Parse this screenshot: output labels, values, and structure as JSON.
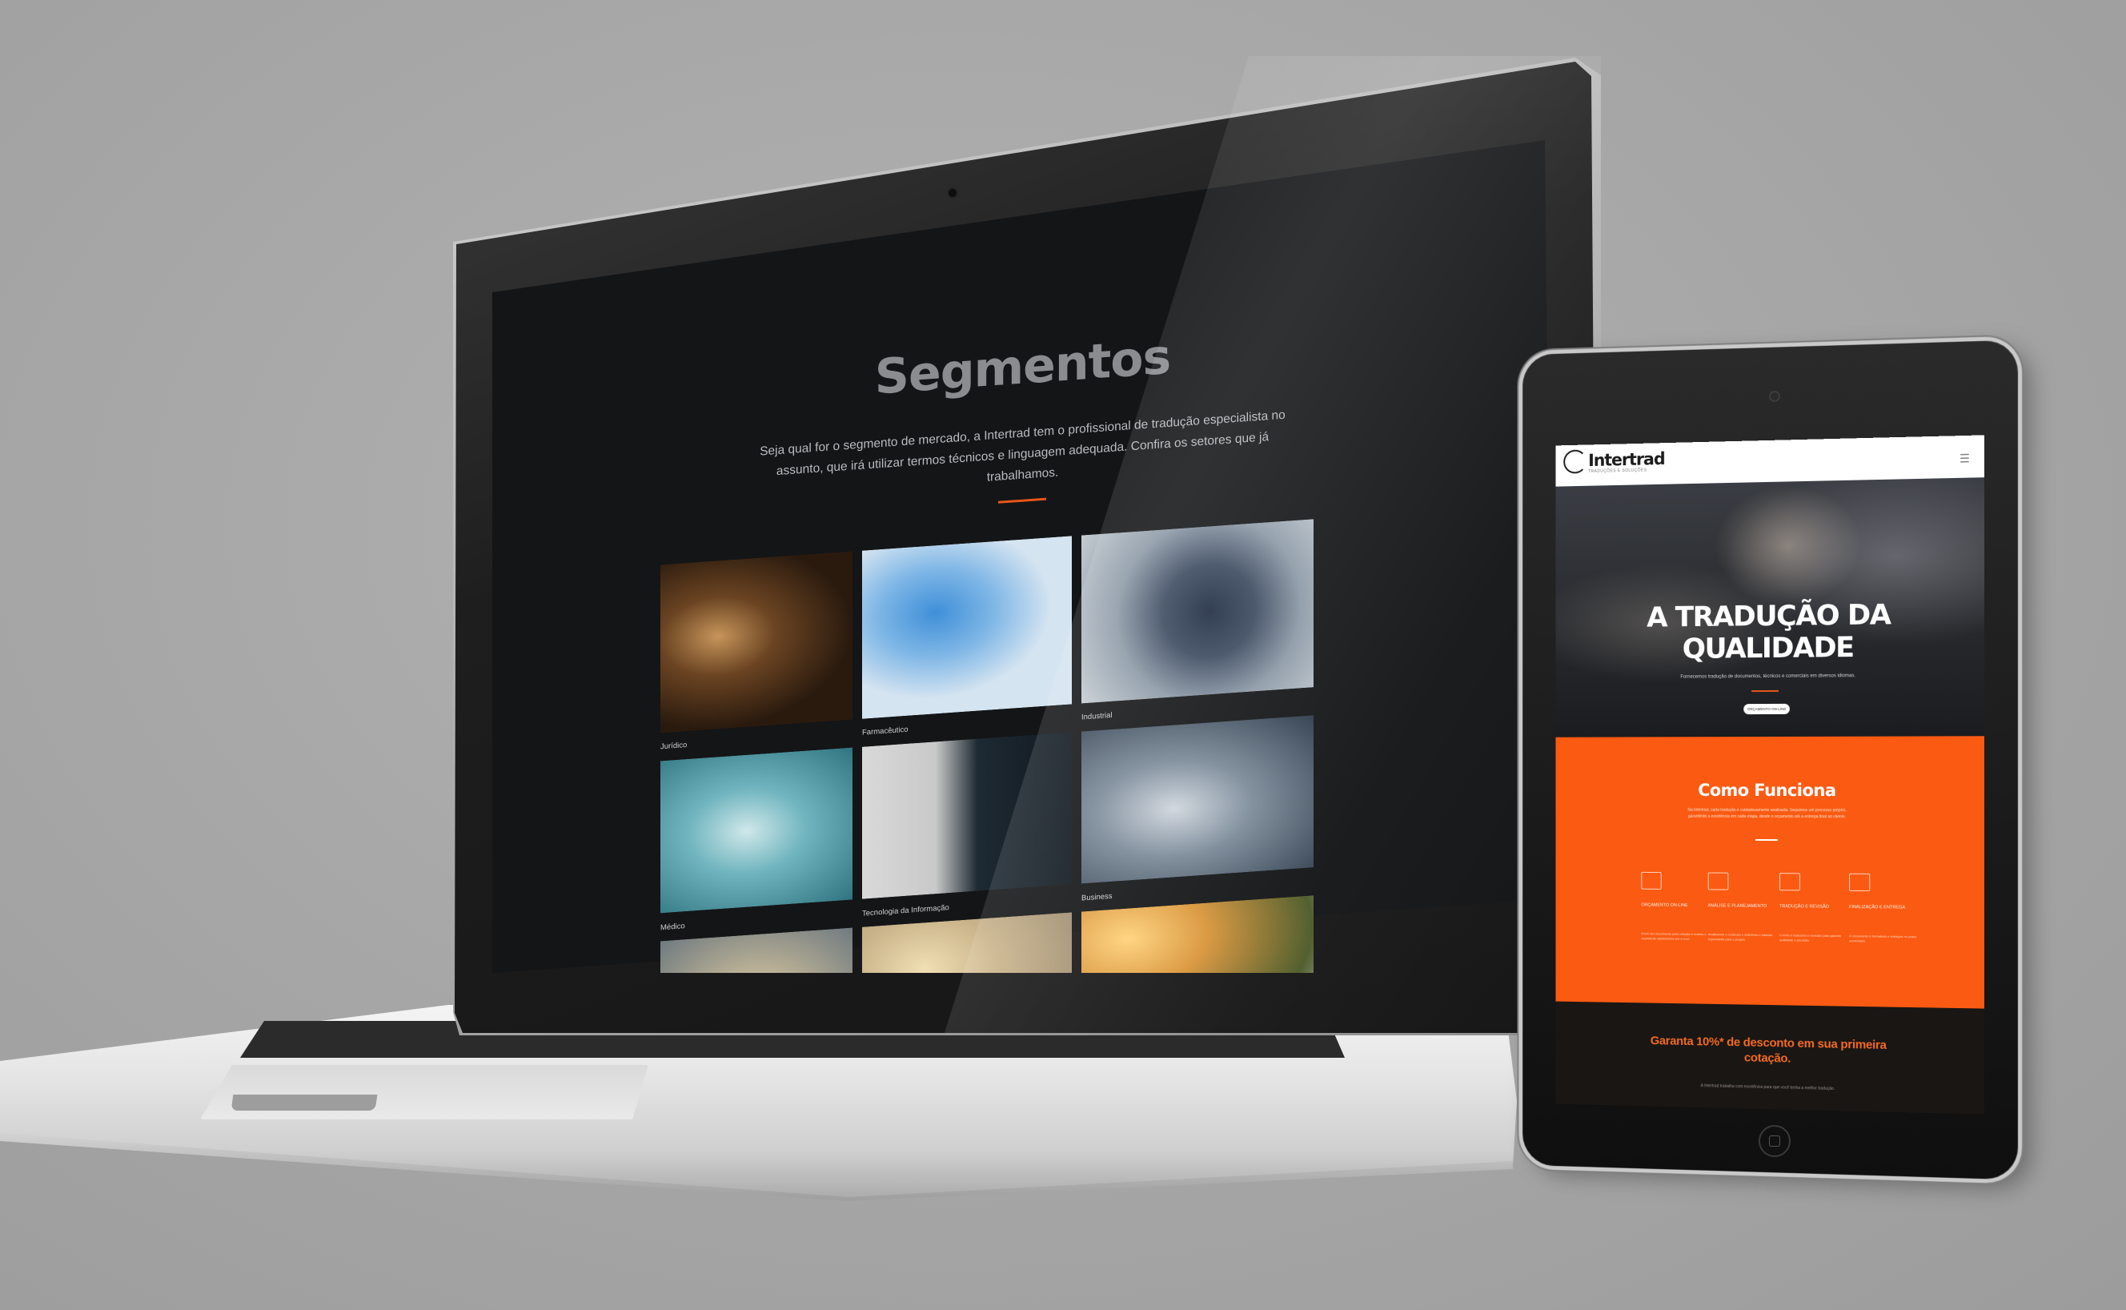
{
  "desktop": {
    "title": "Segmentos",
    "description": "Seja qual for o segmento de mercado, a Intertrad tem o profissional de tradução especialista no assunto, que irá utilizar termos técnicos e linguagem adequada. Confira os setores que já trabalhamos.",
    "segments": [
      {
        "label": "Jurídico"
      },
      {
        "label": "Farmacêutico"
      },
      {
        "label": "Industrial"
      },
      {
        "label": "Médico"
      },
      {
        "label": "Tecnologia da Informação"
      },
      {
        "label": "Business"
      },
      {
        "label": ""
      },
      {
        "label": ""
      },
      {
        "label": ""
      }
    ],
    "accent": "#e8561a"
  },
  "tablet": {
    "logo": "Intertrad",
    "logo_sub": "TRADUÇÕES E SOLUÇÕES",
    "menu_icon": "hamburger-icon",
    "hero_title": "A TRADUÇÃO DA QUALIDADE",
    "hero_sub": "Fornecemos tradução de documentos, técnicos e comerciais em diversos idiomas.",
    "hero_button": "ORÇAMENTO ON-LINE",
    "como_title": "Como Funciona",
    "como_desc": "Na Intertrad, cada tradução é cuidadosamente analisada. Seguimos um processo próprio, garantindo a excelência em cada etapa, desde o orçamento até a entrega final ao cliente.",
    "steps": [
      {
        "icon": "monitor-icon",
        "label": "ORÇAMENTO ON-LINE",
        "text": "Envie seu documento para cotação e receba o orçamento rapidamente por e-mail."
      },
      {
        "icon": "calendar-icon",
        "label": "ANÁLISE E PLANEJAMENTO",
        "text": "Analisamos o conteúdo e definimos o tradutor especialista para o projeto."
      },
      {
        "icon": "document-icon",
        "label": "TRADUÇÃO E REVISÃO",
        "text": "O texto é traduzido e revisado para garantir qualidade e precisão."
      },
      {
        "icon": "delivery-icon",
        "label": "FINALIZAÇÃO E ENTREGA",
        "text": "O documento é formatado e entregue no prazo combinado."
      }
    ],
    "promo": "Garanta 10%* de desconto em sua primeira cotação.",
    "promo_small": "A Intertrad trabalha com excelência para que você tenha a melhor tradução.",
    "orange": "#fb5a12"
  }
}
